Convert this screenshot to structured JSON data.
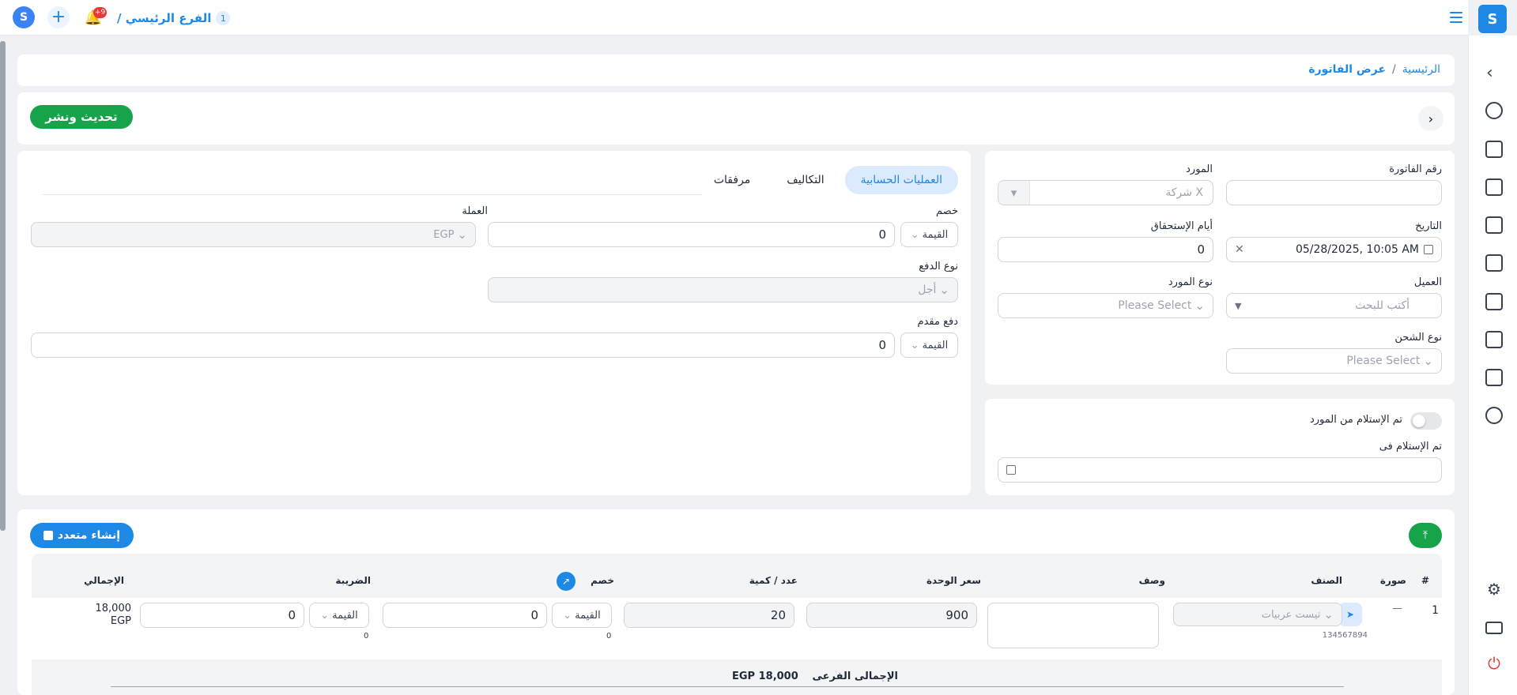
{
  "topbar": {
    "branch_number": "1",
    "branch_name": "الفرع الرئيسي /",
    "notifications_badge": "+9"
  },
  "breadcrumb": {
    "home": "الرئيسية",
    "separator": "/",
    "current": "عرض الفاتورة"
  },
  "actions": {
    "publish_label": "تحديث ونشر"
  },
  "invoice_form": {
    "invoice_number_label": "رقم الفاتورة",
    "invoice_number_value": "",
    "supplier_label": "المورد",
    "supplier_value": "شركة X",
    "date_label": "التاريخ",
    "date_value": "05/28/2025, 10:05 AM",
    "due_days_label": "أيام الإستحقاق",
    "due_days_value": "0",
    "client_label": "العميل",
    "client_placeholder": "أكتب للبحث",
    "supplier_type_label": "نوع المورد",
    "supplier_type_placeholder": "Please Select",
    "shipping_type_label": "نوع الشحن",
    "shipping_type_placeholder": "Please Select"
  },
  "receipt": {
    "received_toggle_label": "تم الإستلام من المورد",
    "received_at_label": "تم الإستلام فى",
    "received_at_value": ""
  },
  "tabs": {
    "accounting": "العمليات الحسابية",
    "costs": "التكاليف",
    "attachments": "مرفقات"
  },
  "accounting": {
    "discount_label": "خصم",
    "discount_type": "القيمة",
    "discount_value": "0",
    "currency_label": "العملة",
    "currency_value": "EGP",
    "payment_type_label": "نوع الدفع",
    "payment_type_value": "أجل",
    "advance_label": "دفع مقدم",
    "advance_type": "القيمة",
    "advance_value": "0"
  },
  "items": {
    "create_multi_label": "إنشاء متعدد",
    "headers": {
      "index": "#",
      "image": "صورة",
      "item": "الصنف",
      "description": "وصف",
      "unit_price": "سعر الوحدة",
      "quantity": "عدد / كمية",
      "discount": "خصم",
      "tax": "الضريبة",
      "total": "الإجمالي"
    },
    "rows": [
      {
        "index": "1",
        "image": "—",
        "item": "تيست عربيات",
        "barcode": "134567894",
        "description": "",
        "unit_price": "900",
        "quantity": "20",
        "discount_type": "القيمة",
        "discount_value": "0",
        "discount_note": "0",
        "tax_type": "القيمة",
        "tax_value": "0",
        "tax_note": "0",
        "total_amount": "18,000",
        "total_currency": "EGP"
      }
    ],
    "subtotal_label": "الإجمالى الفرعى",
    "subtotal_value": "EGP 18,000"
  }
}
